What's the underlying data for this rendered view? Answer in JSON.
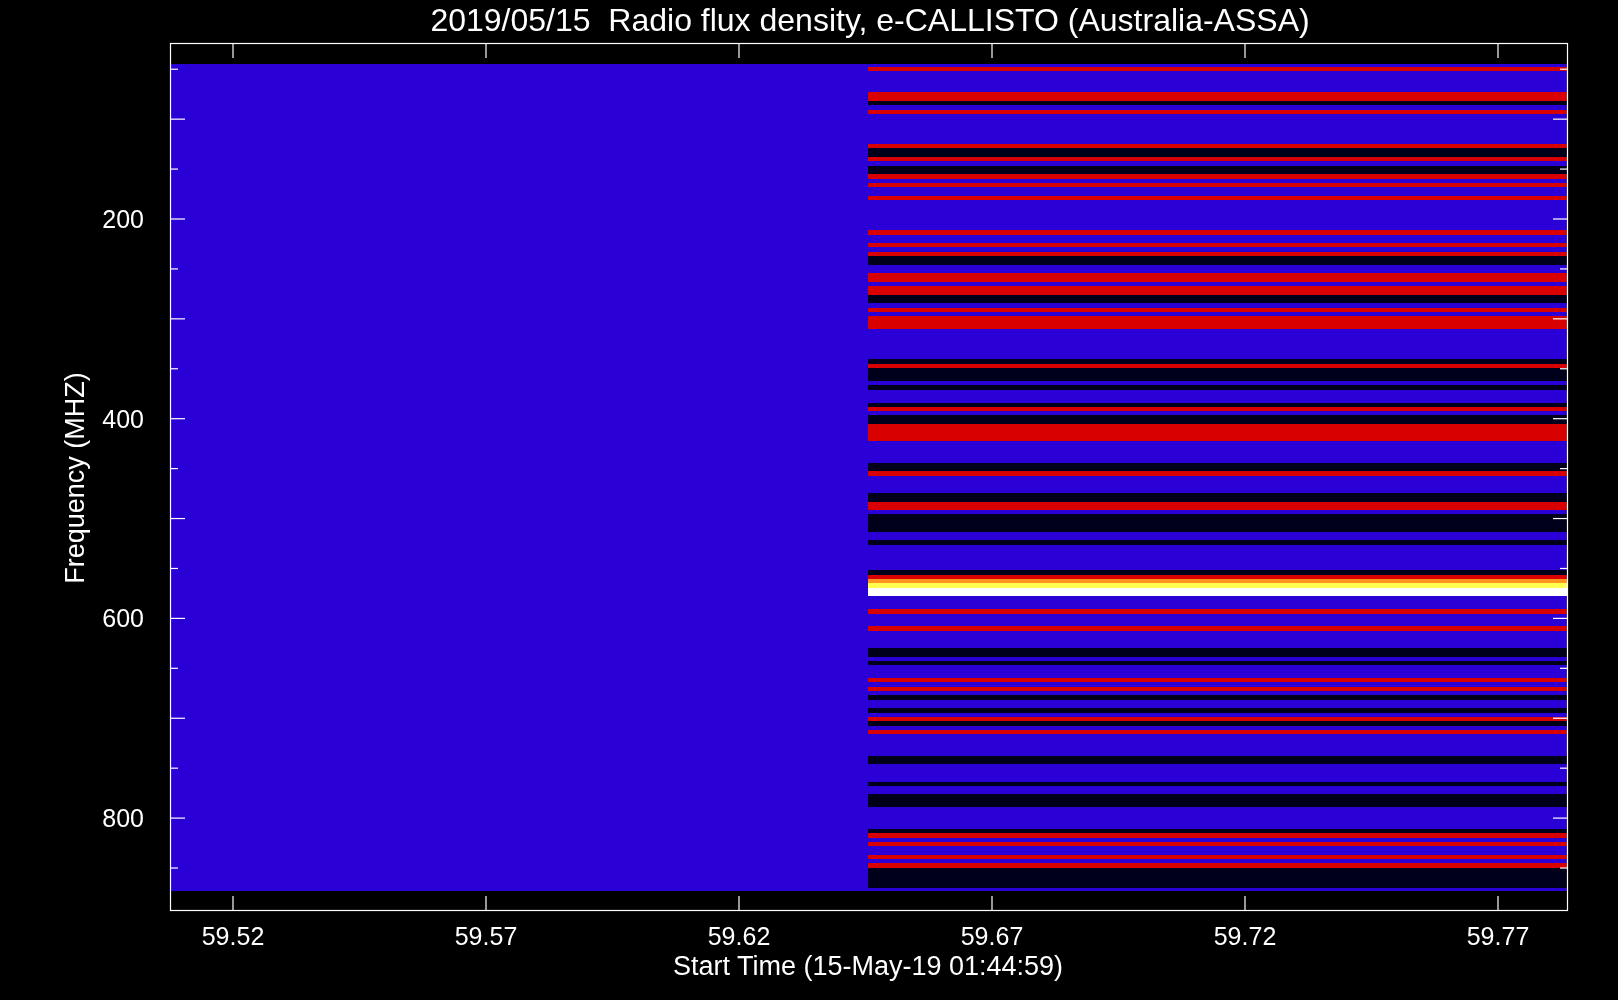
{
  "title": "2019/05/15  Radio flux density, e-CALLISTO (Australia-ASSA)",
  "plot": {
    "ylabel": "Frequency (MHZ)",
    "xlabel": "Start Time (15-May-19 01:44:59)",
    "yticks": [
      "200",
      "400",
      "600",
      "800"
    ],
    "xticks": [
      "59.52",
      "59.57",
      "59.62",
      "59.67",
      "59.72",
      "59.77"
    ]
  }
}
